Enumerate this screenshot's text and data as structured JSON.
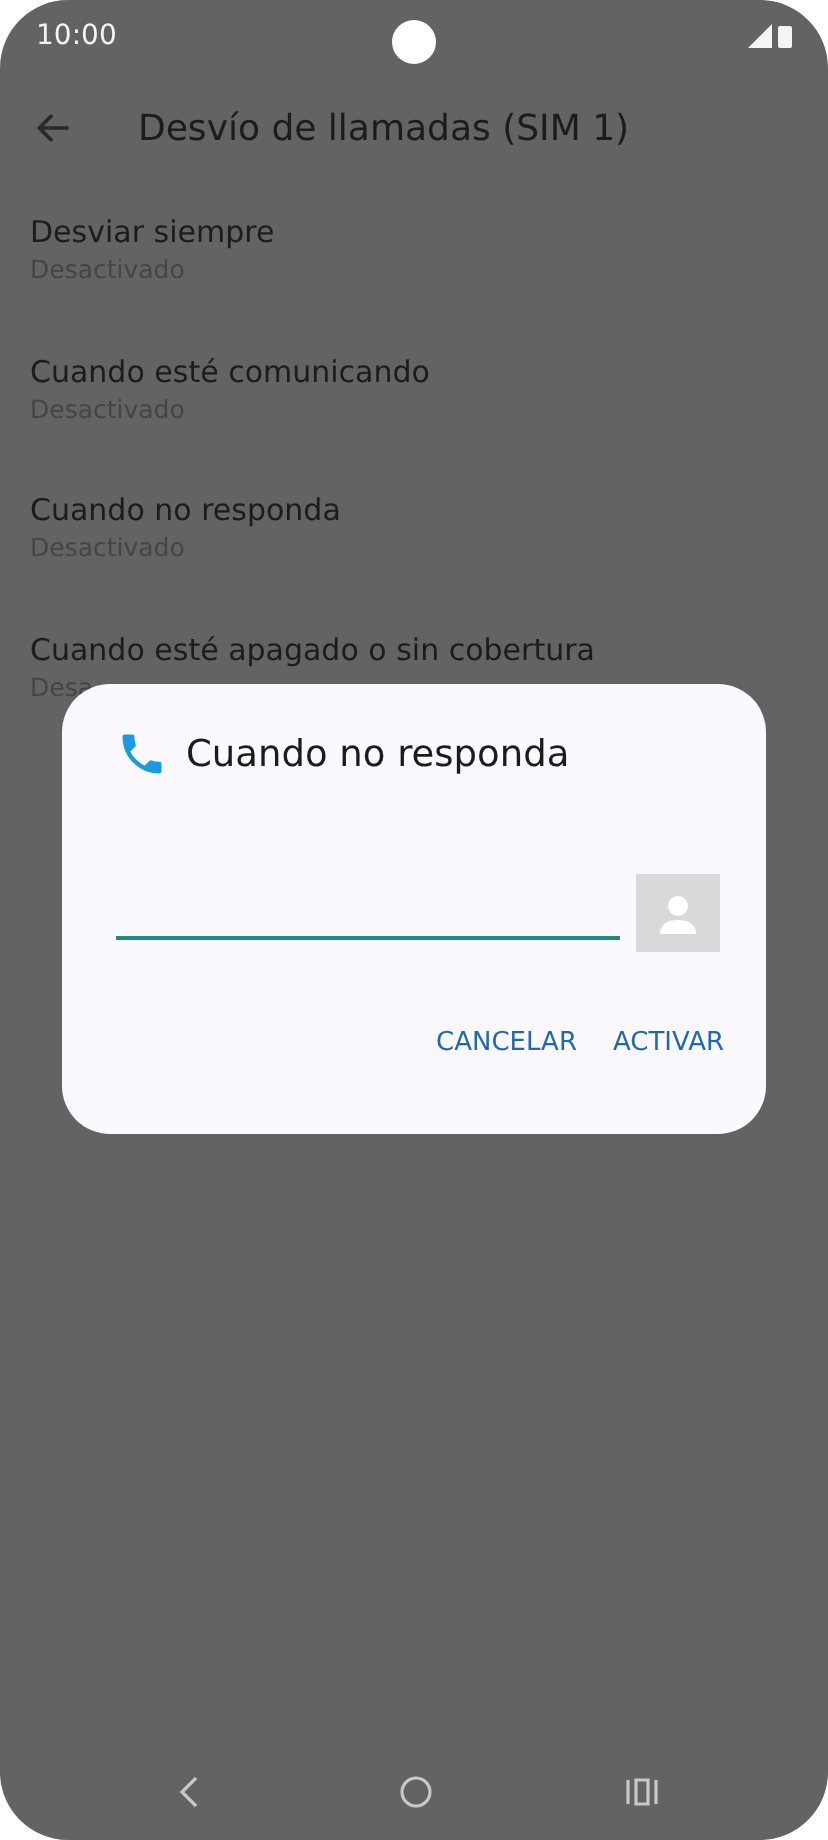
{
  "status_bar": {
    "time": "10:00"
  },
  "header": {
    "title": "Desvío de llamadas (SIM 1)"
  },
  "settings": [
    {
      "title": "Desviar siempre",
      "subtitle": "Desactivado"
    },
    {
      "title": "Cuando esté comunicando",
      "subtitle": "Desactivado"
    },
    {
      "title": "Cuando no responda",
      "subtitle": "Desactivado"
    },
    {
      "title": "Cuando esté apagado o sin cobertura",
      "subtitle": "Desa"
    }
  ],
  "dialog": {
    "title": "Cuando no responda",
    "buttons": [
      "CANCELAR",
      "ACTIVAR"
    ]
  }
}
